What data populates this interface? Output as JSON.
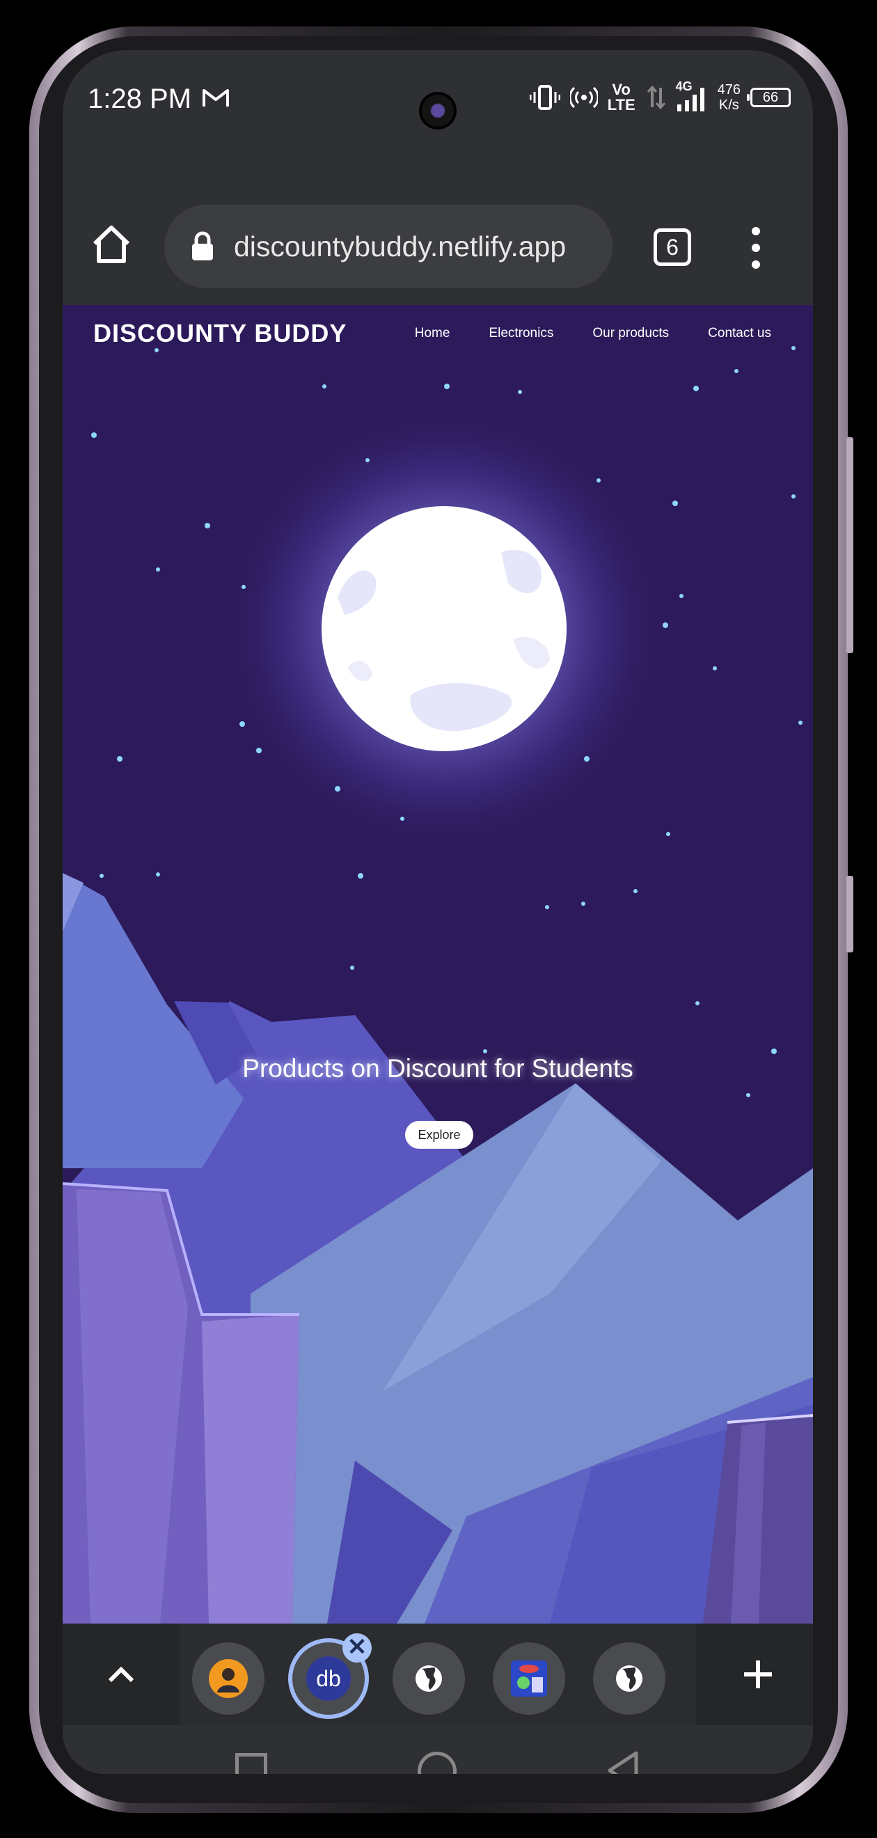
{
  "status_bar": {
    "time": "1:28 PM",
    "volte_top": "Vo",
    "volte_bottom": "LTE",
    "network_type": "4G",
    "speed_value": "476",
    "speed_unit": "K/s",
    "battery": "66",
    "icons": [
      "gmail-icon",
      "vibrate-icon",
      "hotspot-icon",
      "data-arrows-icon",
      "signal-icon",
      "battery-icon"
    ]
  },
  "browser": {
    "url": "discountybuddy.netlify.app",
    "tab_count": "6",
    "icons": [
      "home-icon",
      "lock-icon",
      "tabs-icon",
      "more-vert-icon"
    ]
  },
  "site": {
    "brand": "DISCOUNTY BUDDY",
    "nav": [
      "Home",
      "Electronics",
      "Our products",
      "Contact us"
    ],
    "hero_title": "Products on Discount for Students",
    "cta": "Explore"
  },
  "tab_strip": {
    "tabs": [
      {
        "icon": "avatar-favicon-icon",
        "selected": false
      },
      {
        "icon": "db-favicon-icon",
        "label": "db",
        "selected": true
      },
      {
        "icon": "globe-icon",
        "selected": false
      },
      {
        "icon": "alien-favicon-icon",
        "selected": false
      },
      {
        "icon": "globe-icon",
        "selected": false
      }
    ],
    "close_label": "✕",
    "icons": [
      "chevron-up-icon",
      "plus-icon"
    ]
  },
  "system_nav": {
    "icons": [
      "recents-square-icon",
      "home-circle-icon",
      "back-triangle-icon"
    ]
  },
  "colors": {
    "sky": "#2c1a5a",
    "moon": "#ffffff",
    "mountain_light": "#7289c8",
    "mountain_mid": "#5b5cc4",
    "rock": "#6c5ab5",
    "accent_selected": "#9db9f6"
  }
}
